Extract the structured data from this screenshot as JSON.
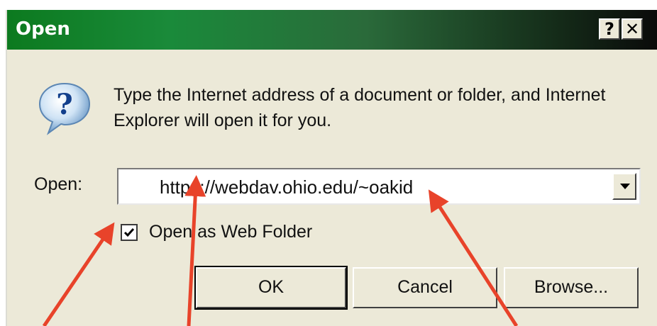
{
  "window": {
    "title": "Open",
    "help_button": "?",
    "close_button": "✕"
  },
  "message": "Type the Internet address of a document or folder, and Internet Explorer will open it for you.",
  "open_field": {
    "label": "Open:",
    "value": "https://webdav.ohio.edu/~oakid"
  },
  "checkbox": {
    "label": "Open as Web Folder",
    "checked": true
  },
  "buttons": {
    "ok": "OK",
    "cancel": "Cancel",
    "browse": "Browse..."
  },
  "colors": {
    "annotation_arrow": "#e8432a",
    "dialog_background": "#ece9d8",
    "titlebar_start": "#0c7a1f",
    "titlebar_end": "#0a0a0a"
  },
  "icons": {
    "dialog_icon": "question-bubble-icon",
    "dropdown": "chevron-down-icon",
    "checkmark": "checkmark-icon"
  }
}
